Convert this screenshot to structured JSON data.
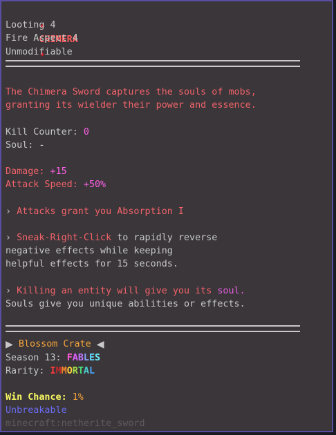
{
  "item": {
    "title_prefix_icon": "✦",
    "title": "CHIMERA",
    "title_suffix_icon": "✦",
    "enchant_1": "Looting 4",
    "enchant_2": "Fire Aspect 4",
    "unmodifiable": "Unmodifiable"
  },
  "description": {
    "line_1": "The Chimera Sword captures the souls of mobs,",
    "line_2": "granting its wielder their power and essence."
  },
  "stats": {
    "kill_counter_label": "Kill Counter:",
    "kill_counter_value": "0",
    "soul_label": "Soul:",
    "soul_value": "-",
    "damage_label": "Damage:",
    "damage_value": "+15",
    "attack_speed_label": "Attack Speed:",
    "attack_speed_value": "+50%"
  },
  "abilities": {
    "bullet": "›",
    "a1": "Attacks grant you Absorption I",
    "a2_highlight": "Sneak-Right-Click",
    "a2_rest": " to rapidly reverse",
    "a2_line2": "negative effects while keeping",
    "a2_line3": "helpful effects for 15 seconds.",
    "a3_prefix": "Killing an entity will give you its ",
    "a3_soul": "soul.",
    "a3_line2": "Souls give you unique abilities or effects."
  },
  "crate": {
    "left_icon": "▶",
    "name": "Blossom Crate",
    "right_icon": "◀",
    "season_label": "Season 13:",
    "season_value": "FABLES",
    "rarity_label": "Rarity:",
    "rarity_value": "IMMORTAL",
    "win_chance_label": "Win Chance:",
    "win_chance_value": "1%",
    "unbreakable": "Unbreakable",
    "item_id": "minecraft:netherite_sword"
  },
  "colors": {
    "background": "#3a3639",
    "border": "#5a4ea4",
    "title": "#ff5a5a",
    "red_text": "#f2636b",
    "pink_text": "#fd61e7",
    "gold_text": "#f6a53c",
    "yellow_text": "#fafa62",
    "blue_text": "#6c6cf4"
  }
}
